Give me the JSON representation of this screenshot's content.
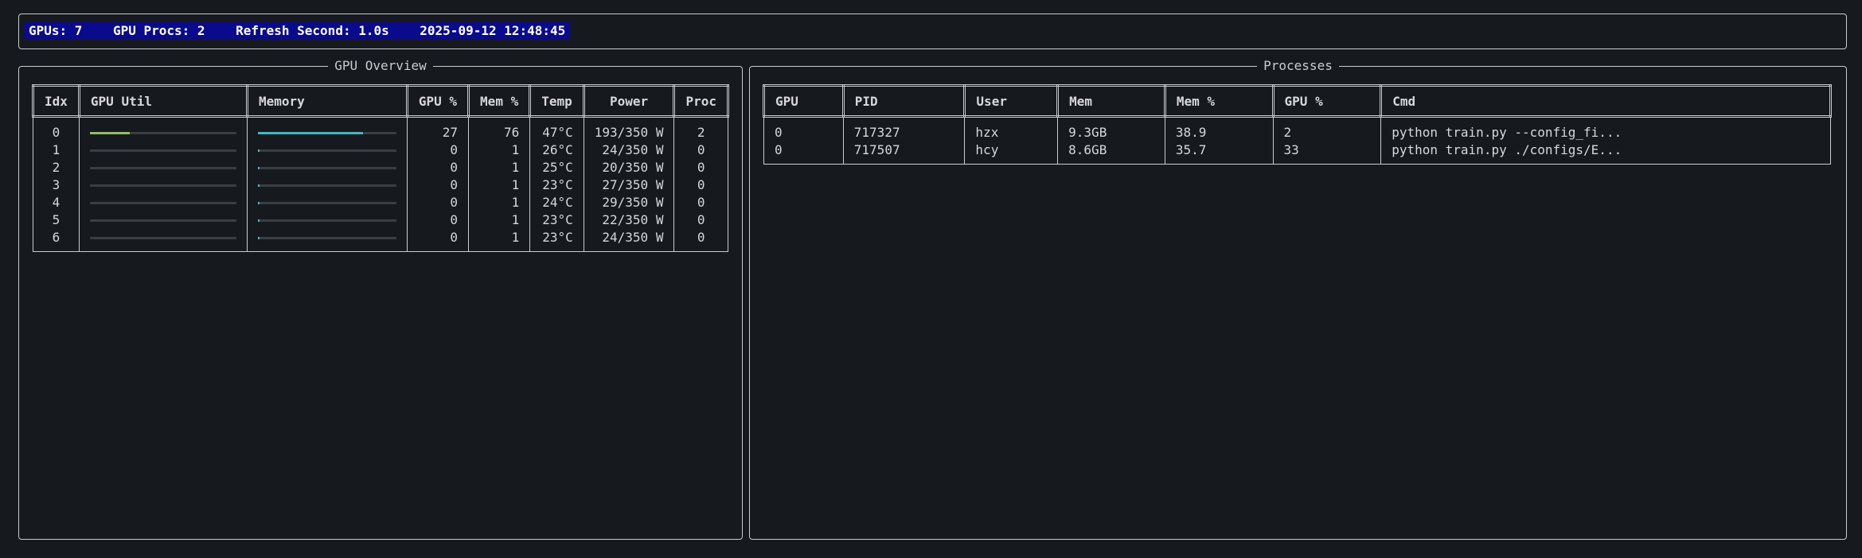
{
  "status": {
    "text": "GPUs: 7    GPU Procs: 2    Refresh Second: 1.0s    2025-09-12 12:48:45"
  },
  "gpu_overview": {
    "title": "GPU Overview",
    "headers": [
      "Idx",
      "GPU Util",
      "Memory",
      "GPU %",
      "Mem %",
      "Temp",
      "Power",
      "Proc"
    ],
    "util_color": "#8fbf5a",
    "mem_color": "#43b7c7",
    "rows": [
      {
        "idx": "0",
        "gpu_pct": "27",
        "mem_pct": "76",
        "temp": "47°C",
        "power": "193/350 W",
        "proc": "2",
        "util": 0.27,
        "mem": 0.76
      },
      {
        "idx": "1",
        "gpu_pct": "0",
        "mem_pct": "1",
        "temp": "26°C",
        "power": "24/350 W",
        "proc": "0",
        "util": 0,
        "mem": 0.01
      },
      {
        "idx": "2",
        "gpu_pct": "0",
        "mem_pct": "1",
        "temp": "25°C",
        "power": "20/350 W",
        "proc": "0",
        "util": 0,
        "mem": 0.01
      },
      {
        "idx": "3",
        "gpu_pct": "0",
        "mem_pct": "1",
        "temp": "23°C",
        "power": "27/350 W",
        "proc": "0",
        "util": 0,
        "mem": 0.01
      },
      {
        "idx": "4",
        "gpu_pct": "0",
        "mem_pct": "1",
        "temp": "24°C",
        "power": "29/350 W",
        "proc": "0",
        "util": 0,
        "mem": 0.01
      },
      {
        "idx": "5",
        "gpu_pct": "0",
        "mem_pct": "1",
        "temp": "23°C",
        "power": "22/350 W",
        "proc": "0",
        "util": 0,
        "mem": 0.01
      },
      {
        "idx": "6",
        "gpu_pct": "0",
        "mem_pct": "1",
        "temp": "23°C",
        "power": "24/350 W",
        "proc": "0",
        "util": 0,
        "mem": 0.01
      }
    ]
  },
  "processes": {
    "title": "Processes",
    "headers": [
      "GPU",
      "PID",
      "User",
      "Mem",
      "Mem %",
      "GPU %",
      "Cmd"
    ],
    "rows": [
      {
        "gpu": "0",
        "pid": "717327",
        "user": "hzx",
        "mem": "9.3GB",
        "mem_pct": "38.9",
        "gpu_pct": "2",
        "cmd": "python train.py --config_fi..."
      },
      {
        "gpu": "0",
        "pid": "717507",
        "user": "hcy",
        "mem": "8.6GB",
        "mem_pct": "35.7",
        "gpu_pct": "33",
        "cmd": "python train.py ./configs/E..."
      }
    ]
  }
}
